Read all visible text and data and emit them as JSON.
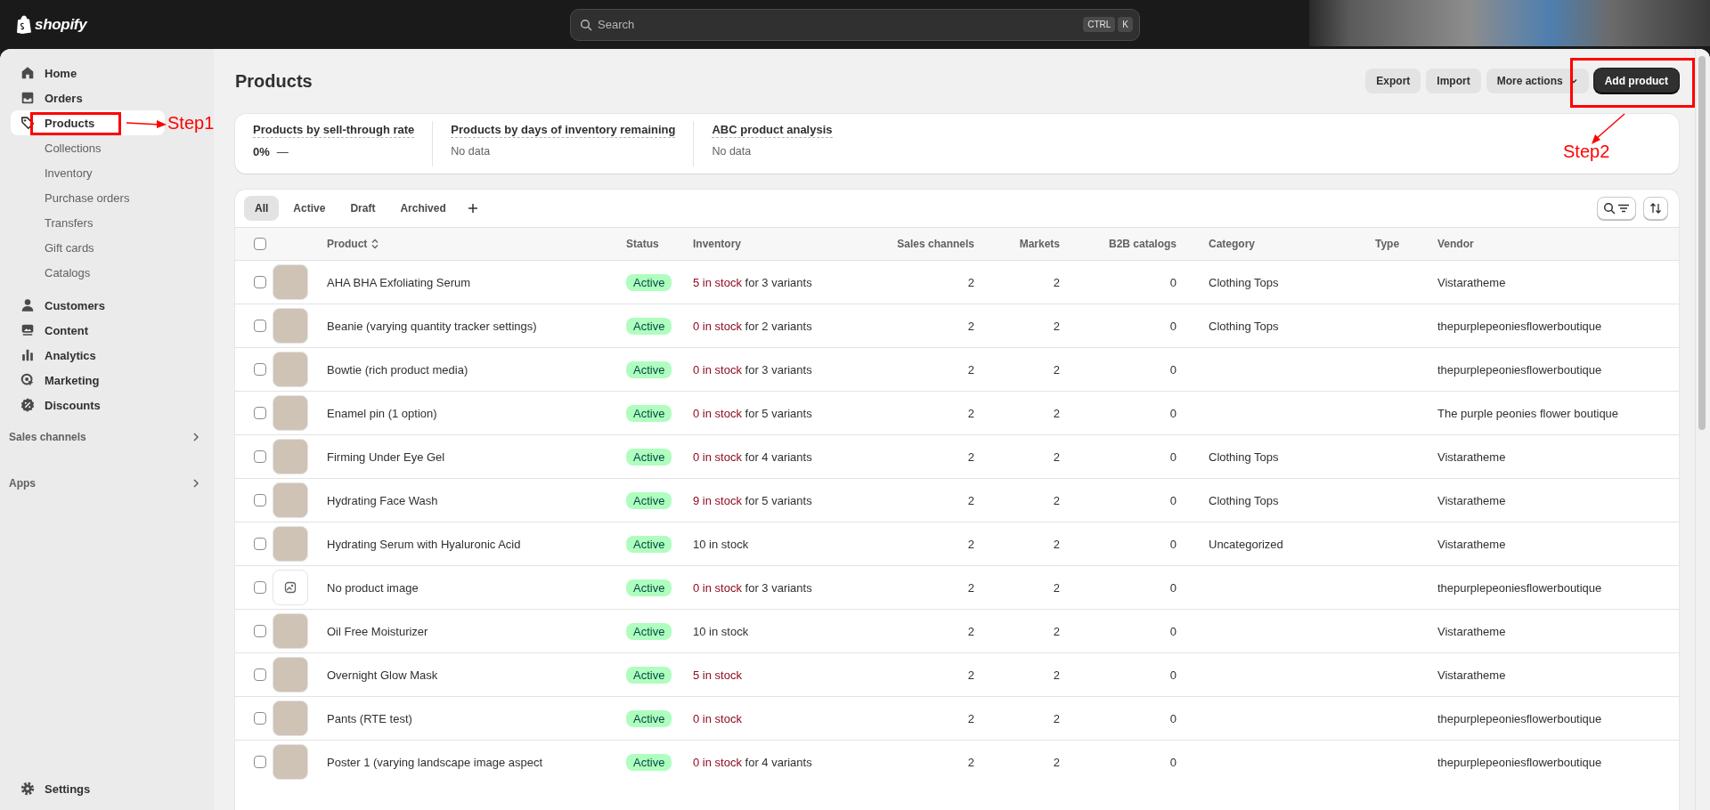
{
  "top_bar": {
    "logo_text": "shopify",
    "search": {
      "placeholder": "Search",
      "shortcut": [
        "CTRL",
        "K"
      ]
    }
  },
  "sidebar": {
    "items": [
      {
        "kind": "home",
        "label": "Home",
        "selected": false
      },
      {
        "kind": "orders",
        "label": "Orders",
        "selected": false
      },
      {
        "kind": "products",
        "label": "Products",
        "selected": true,
        "children": [
          {
            "label": "Collections",
            "selected": false
          },
          {
            "label": "Inventory",
            "selected": false
          },
          {
            "label": "Purchase orders",
            "selected": false
          },
          {
            "label": "Transfers",
            "selected": false
          },
          {
            "label": "Gift cards",
            "selected": false
          },
          {
            "label": "Catalogs",
            "selected": false
          }
        ]
      },
      {
        "kind": "customers",
        "label": "Customers",
        "selected": false
      },
      {
        "kind": "content",
        "label": "Content",
        "selected": false
      },
      {
        "kind": "analytics",
        "label": "Analytics",
        "selected": false
      },
      {
        "kind": "marketing",
        "label": "Marketing",
        "selected": false
      },
      {
        "kind": "discounts",
        "label": "Discounts",
        "selected": false
      }
    ],
    "sections": [
      {
        "label": "Sales channels"
      },
      {
        "label": "Apps"
      }
    ],
    "footer": {
      "kind": "settings",
      "label": "Settings"
    }
  },
  "page": {
    "title": "Products",
    "actions": [
      {
        "kind": "secondary",
        "label": "Export"
      },
      {
        "kind": "secondary",
        "label": "Import"
      },
      {
        "kind": "menu",
        "label": "More actions"
      },
      {
        "kind": "primary",
        "label": "Add product"
      }
    ]
  },
  "metrics": [
    {
      "kind": "rate",
      "title": "Products by sell-through rate",
      "value": "0%",
      "trend": "—"
    },
    {
      "kind": "empty",
      "title": "Products by days of inventory remaining",
      "value": "No data"
    },
    {
      "kind": "empty",
      "title": "ABC product analysis",
      "value": "No data"
    }
  ],
  "tabs": [
    {
      "label": "All",
      "selected": true
    },
    {
      "label": "Active",
      "selected": false
    },
    {
      "label": "Draft",
      "selected": false
    },
    {
      "label": "Archived",
      "selected": false
    }
  ],
  "table": {
    "select_all": {
      "checked": false
    },
    "columns": [
      {
        "label": "Product",
        "sortable": true
      },
      {
        "label": "Status",
        "sortable": false
      },
      {
        "label": "Inventory",
        "sortable": false
      },
      {
        "label": "Sales channels",
        "sortable": false
      },
      {
        "label": "Markets",
        "sortable": false
      },
      {
        "label": "B2B catalogs",
        "sortable": false
      },
      {
        "label": "Category",
        "sortable": false
      },
      {
        "label": "Type",
        "sortable": false
      },
      {
        "label": "Vendor",
        "sortable": false
      }
    ],
    "rows": [
      {
        "checked": false,
        "kind": "photo",
        "product": "AHA BHA Exfoliating Serum",
        "status": "Active",
        "stock": "5 in stock",
        "stock_low": true,
        "stock_detail": "for 3 variants",
        "sales_channels": "2",
        "markets": "2",
        "b2b_catalogs": "0",
        "category": "Clothing Tops",
        "vendor": "Vistaratheme"
      },
      {
        "checked": false,
        "kind": "photo",
        "product": "Beanie (varying quantity tracker settings)",
        "status": "Active",
        "stock": "0 in stock",
        "stock_low": true,
        "stock_detail": "for 2 variants",
        "sales_channels": "2",
        "markets": "2",
        "b2b_catalogs": "0",
        "category": "Clothing Tops",
        "vendor": "thepurplepeoniesflowerboutique"
      },
      {
        "checked": false,
        "kind": "photo",
        "product": "Bowtie (rich product media)",
        "status": "Active",
        "stock": "0 in stock",
        "stock_low": true,
        "stock_detail": "for 3 variants",
        "sales_channels": "2",
        "markets": "2",
        "b2b_catalogs": "0",
        "vendor": "thepurplepeoniesflowerboutique"
      },
      {
        "checked": false,
        "kind": "photo",
        "product": "Enamel pin (1 option)",
        "status": "Active",
        "stock": "0 in stock",
        "stock_low": true,
        "stock_detail": "for 5 variants",
        "sales_channels": "2",
        "markets": "2",
        "b2b_catalogs": "0",
        "vendor": "The purple peonies flower boutique"
      },
      {
        "checked": false,
        "kind": "photo",
        "product": "Firming Under Eye Gel",
        "status": "Active",
        "stock": "0 in stock",
        "stock_low": true,
        "stock_detail": "for 4 variants",
        "sales_channels": "2",
        "markets": "2",
        "b2b_catalogs": "0",
        "category": "Clothing Tops",
        "vendor": "Vistaratheme"
      },
      {
        "checked": false,
        "kind": "photo",
        "product": "Hydrating Face Wash",
        "status": "Active",
        "stock": "9 in stock",
        "stock_low": true,
        "stock_detail": "for 5 variants",
        "sales_channels": "2",
        "markets": "2",
        "b2b_catalogs": "0",
        "category": "Clothing Tops",
        "vendor": "Vistaratheme"
      },
      {
        "checked": false,
        "kind": "photo",
        "product": "Hydrating Serum with Hyaluronic Acid",
        "status": "Active",
        "stock": "10 in stock",
        "stock_low": false,
        "sales_channels": "2",
        "markets": "2",
        "b2b_catalogs": "0",
        "category": "Uncategorized",
        "vendor": "Vistaratheme"
      },
      {
        "checked": false,
        "kind": "none",
        "product": "No product image",
        "status": "Active",
        "stock": "0 in stock",
        "stock_low": true,
        "stock_detail": "for 3 variants",
        "sales_channels": "2",
        "markets": "2",
        "b2b_catalogs": "0",
        "vendor": "thepurplepeoniesflowerboutique"
      },
      {
        "checked": false,
        "kind": "photo",
        "product": "Oil Free Moisturizer",
        "status": "Active",
        "stock": "10 in stock",
        "stock_low": false,
        "sales_channels": "2",
        "markets": "2",
        "b2b_catalogs": "0",
        "vendor": "Vistaratheme"
      },
      {
        "checked": false,
        "kind": "photo",
        "product": "Overnight Glow Mask",
        "status": "Active",
        "stock": "5 in stock",
        "stock_low": true,
        "sales_channels": "2",
        "markets": "2",
        "b2b_catalogs": "0",
        "vendor": "Vistaratheme"
      },
      {
        "checked": false,
        "kind": "photo",
        "product": "Pants (RTE test)",
        "status": "Active",
        "stock": "0 in stock",
        "stock_low": true,
        "sales_channels": "2",
        "markets": "2",
        "b2b_catalogs": "0",
        "vendor": "thepurplepeoniesflowerboutique"
      },
      {
        "checked": false,
        "kind": "photo",
        "product": "Poster 1 (varying landscape image aspect",
        "status": "Active",
        "stock": "0 in stock",
        "stock_low": true,
        "stock_detail": "for 4 variants",
        "sales_channels": "2",
        "markets": "2",
        "b2b_catalogs": "0",
        "vendor": "thepurplepeoniesflowerboutique"
      }
    ]
  },
  "annotations": [
    {
      "kind": "sidebar",
      "label": "Step1"
    },
    {
      "kind": "header",
      "label": "Step2"
    }
  ]
}
